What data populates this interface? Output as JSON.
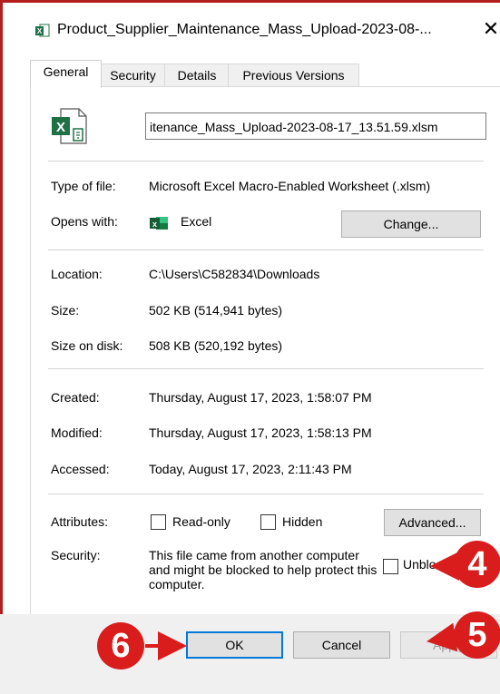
{
  "window": {
    "title": "Product_Supplier_Maintenance_Mass_Upload-2023-08-...",
    "close_glyph": "✕"
  },
  "tabs": [
    {
      "label": "General",
      "active": true
    },
    {
      "label": "Security",
      "active": false
    },
    {
      "label": "Details",
      "active": false
    },
    {
      "label": "Previous Versions",
      "active": false
    }
  ],
  "file": {
    "icon": "excel-file-icon",
    "name_field": "itenance_Mass_Upload-2023-08-17_13.51.59.xlsm"
  },
  "type_section": {
    "type_label": "Type of file:",
    "type_value": "Microsoft Excel Macro-Enabled Worksheet (.xlsm)",
    "opens_label": "Opens with:",
    "opens_value": "Excel",
    "change_button": "Change..."
  },
  "location_section": {
    "location_label": "Location:",
    "location_value": "C:\\Users\\C582834\\Downloads",
    "size_label": "Size:",
    "size_value": "502 KB (514,941 bytes)",
    "disk_label": "Size on disk:",
    "disk_value": "508 KB (520,192 bytes)"
  },
  "dates_section": {
    "created_label": "Created:",
    "created_value": "Thursday, August 17, 2023, 1:58:07 PM",
    "modified_label": "Modified:",
    "modified_value": "Thursday, August 17, 2023, 1:58:13 PM",
    "accessed_label": "Accessed:",
    "accessed_value": "Today, August 17, 2023, 2:11:43 PM"
  },
  "attributes": {
    "label": "Attributes:",
    "readonly_label": "Read-only",
    "readonly_checked": false,
    "hidden_label": "Hidden",
    "hidden_checked": false,
    "advanced_button": "Advanced..."
  },
  "security": {
    "label": "Security:",
    "message": "This file came from another computer and might be blocked to help protect this computer.",
    "unblock_label": "Unblock",
    "unblock_checked": false
  },
  "buttons": {
    "ok": "OK",
    "cancel": "Cancel",
    "apply": "Apply"
  },
  "annotations": {
    "badge_4": "4",
    "badge_5": "5",
    "badge_6": "6",
    "color": "#d91c1c"
  }
}
